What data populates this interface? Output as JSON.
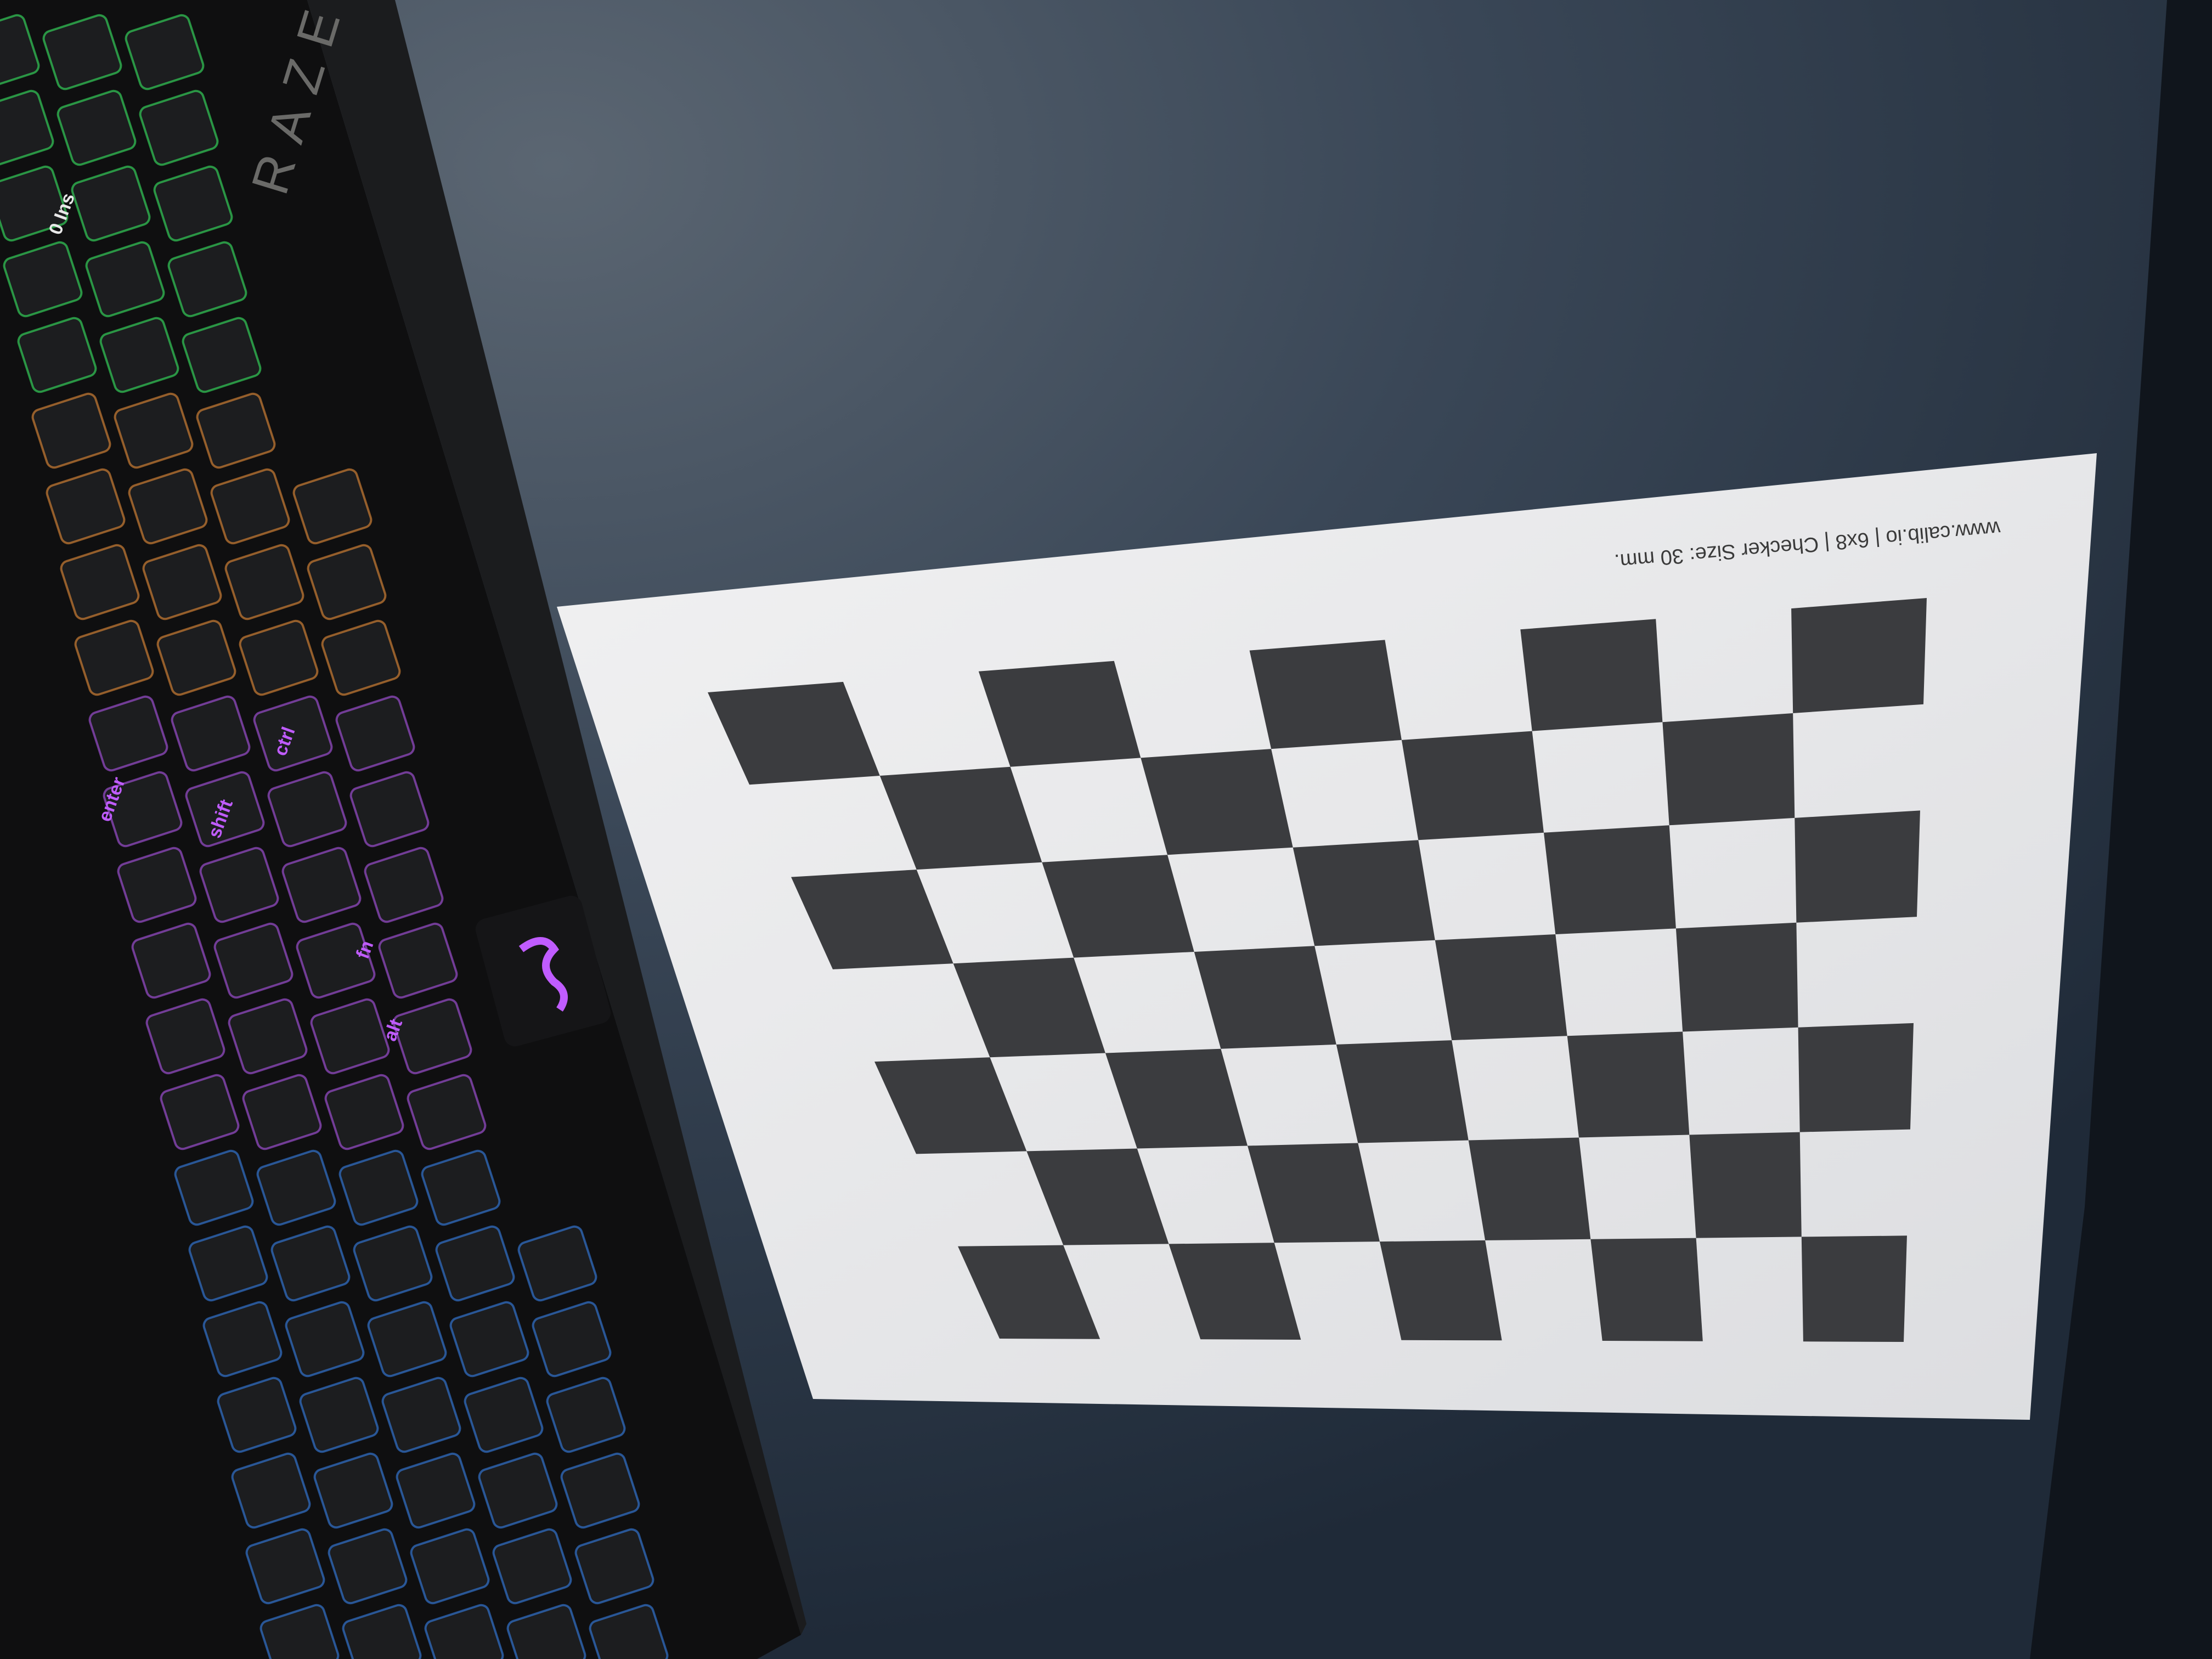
{
  "scene": {
    "description_label": "Photo of a printed checkerboard calibration target on a dark blue surface next to a Razer mechanical keyboard",
    "colors": {
      "surface": "#2c3a4c",
      "surface_light": "#4a5766",
      "paper": "#e9e9ea",
      "checker_dark": "#3b3c3f",
      "keyboard_body": "#0f0f10",
      "key_cap": "#1c1d1f",
      "rgb_green": "#3cff6a",
      "rgb_purple": "#c05cff",
      "rgb_blue": "#3a8cff",
      "rgb_orange": "#ff9a3c"
    }
  },
  "keyboard": {
    "brand": "RAZE",
    "keys": [
      "ctrl",
      "shift",
      "enter",
      "alt",
      "fn",
      "0 Ins"
    ]
  },
  "calibration_target": {
    "header_text": "www.calib.io | 6x8 | Checker Size: 30 mm.",
    "rows": 6,
    "cols": 8,
    "checker_size_mm": 30
  }
}
